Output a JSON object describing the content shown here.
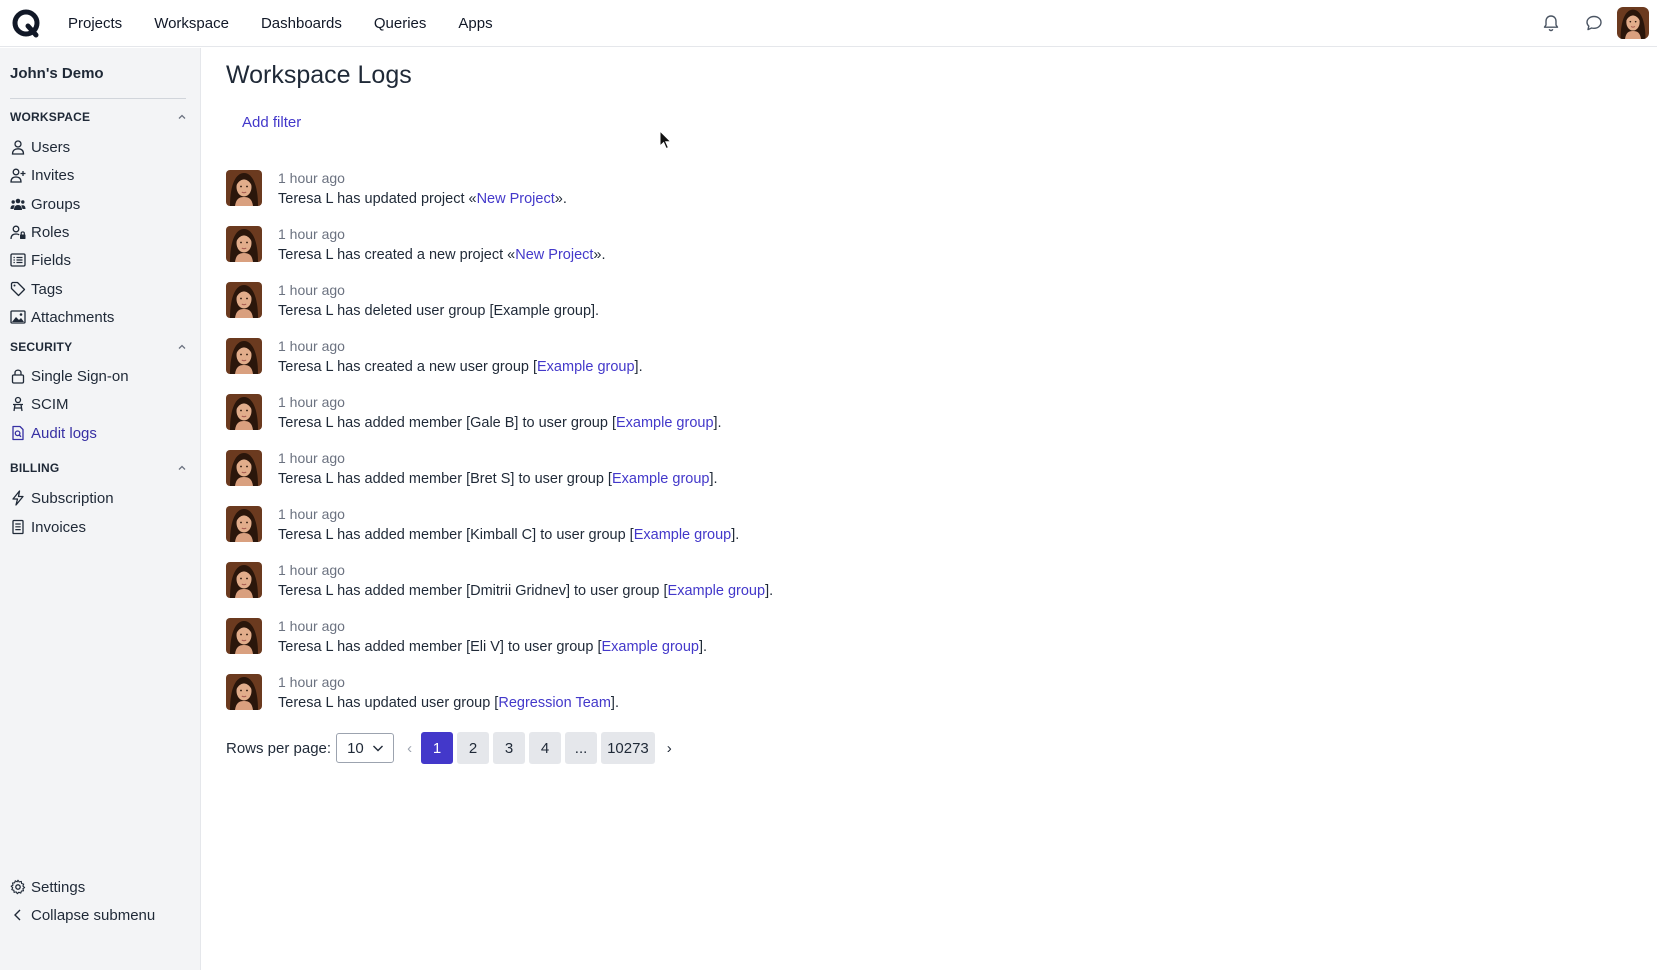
{
  "topnav": {
    "items": [
      {
        "label": "Projects"
      },
      {
        "label": "Workspace"
      },
      {
        "label": "Dashboards"
      },
      {
        "label": "Queries"
      },
      {
        "label": "Apps"
      }
    ]
  },
  "sidebar": {
    "org_name": "John's Demo",
    "sections": {
      "workspace": {
        "title": "WORKSPACE",
        "items": [
          {
            "label": "Users",
            "icon": "user-icon"
          },
          {
            "label": "Invites",
            "icon": "user-plus-icon"
          },
          {
            "label": "Groups",
            "icon": "users-icon"
          },
          {
            "label": "Roles",
            "icon": "user-lock-icon"
          },
          {
            "label": "Fields",
            "icon": "list-icon"
          },
          {
            "label": "Tags",
            "icon": "tag-icon"
          },
          {
            "label": "Attachments",
            "icon": "image-icon"
          }
        ]
      },
      "security": {
        "title": "SECURITY",
        "items": [
          {
            "label": "Single Sign-on",
            "icon": "lock-icon"
          },
          {
            "label": "SCIM",
            "icon": "scim-icon"
          },
          {
            "label": "Audit logs",
            "icon": "audit-icon",
            "active": true
          }
        ]
      },
      "billing": {
        "title": "BILLING",
        "items": [
          {
            "label": "Subscription",
            "icon": "bolt-icon"
          },
          {
            "label": "Invoices",
            "icon": "invoice-icon"
          }
        ]
      }
    },
    "settings_label": "Settings",
    "collapse_label": "Collapse submenu"
  },
  "main": {
    "title": "Workspace Logs",
    "add_filter_label": "Add filter",
    "logs": [
      {
        "time": "1 hour ago",
        "before": "Teresa L has updated project «",
        "link": "New Project",
        "after": "»."
      },
      {
        "time": "1 hour ago",
        "before": "Teresa L has created a new project «",
        "link": "New Project",
        "after": "»."
      },
      {
        "time": "1 hour ago",
        "before": "Teresa L has deleted user group [Example group].",
        "link": "",
        "after": ""
      },
      {
        "time": "1 hour ago",
        "before": "Teresa L has created a new user group [",
        "link": "Example group",
        "after": "]."
      },
      {
        "time": "1 hour ago",
        "before": "Teresa L has added member [Gale B] to user group [",
        "link": "Example group",
        "after": "]."
      },
      {
        "time": "1 hour ago",
        "before": "Teresa L has added member [Bret S] to user group [",
        "link": "Example group",
        "after": "]."
      },
      {
        "time": "1 hour ago",
        "before": "Teresa L has added member [Kimball C] to user group [",
        "link": "Example group",
        "after": "]."
      },
      {
        "time": "1 hour ago",
        "before": "Teresa L has added member [Dmitrii Gridnev] to user group [",
        "link": "Example group",
        "after": "]."
      },
      {
        "time": "1 hour ago",
        "before": "Teresa L has added member [Eli V] to user group [",
        "link": "Example group",
        "after": "]."
      },
      {
        "time": "1 hour ago",
        "before": "Teresa L has updated user group [",
        "link": "Regression Team",
        "after": "]."
      }
    ],
    "pagination": {
      "rows_label": "Rows per page:",
      "rows_value": "10",
      "prev": "‹",
      "next": "›",
      "pages": [
        "1",
        "2",
        "3",
        "4",
        "...",
        "10273"
      ],
      "current": "1"
    }
  },
  "colors": {
    "accent": "#4338ca",
    "sidebar_bg": "#f3f4f6",
    "text": "#1f2937",
    "muted": "#6b7280"
  }
}
